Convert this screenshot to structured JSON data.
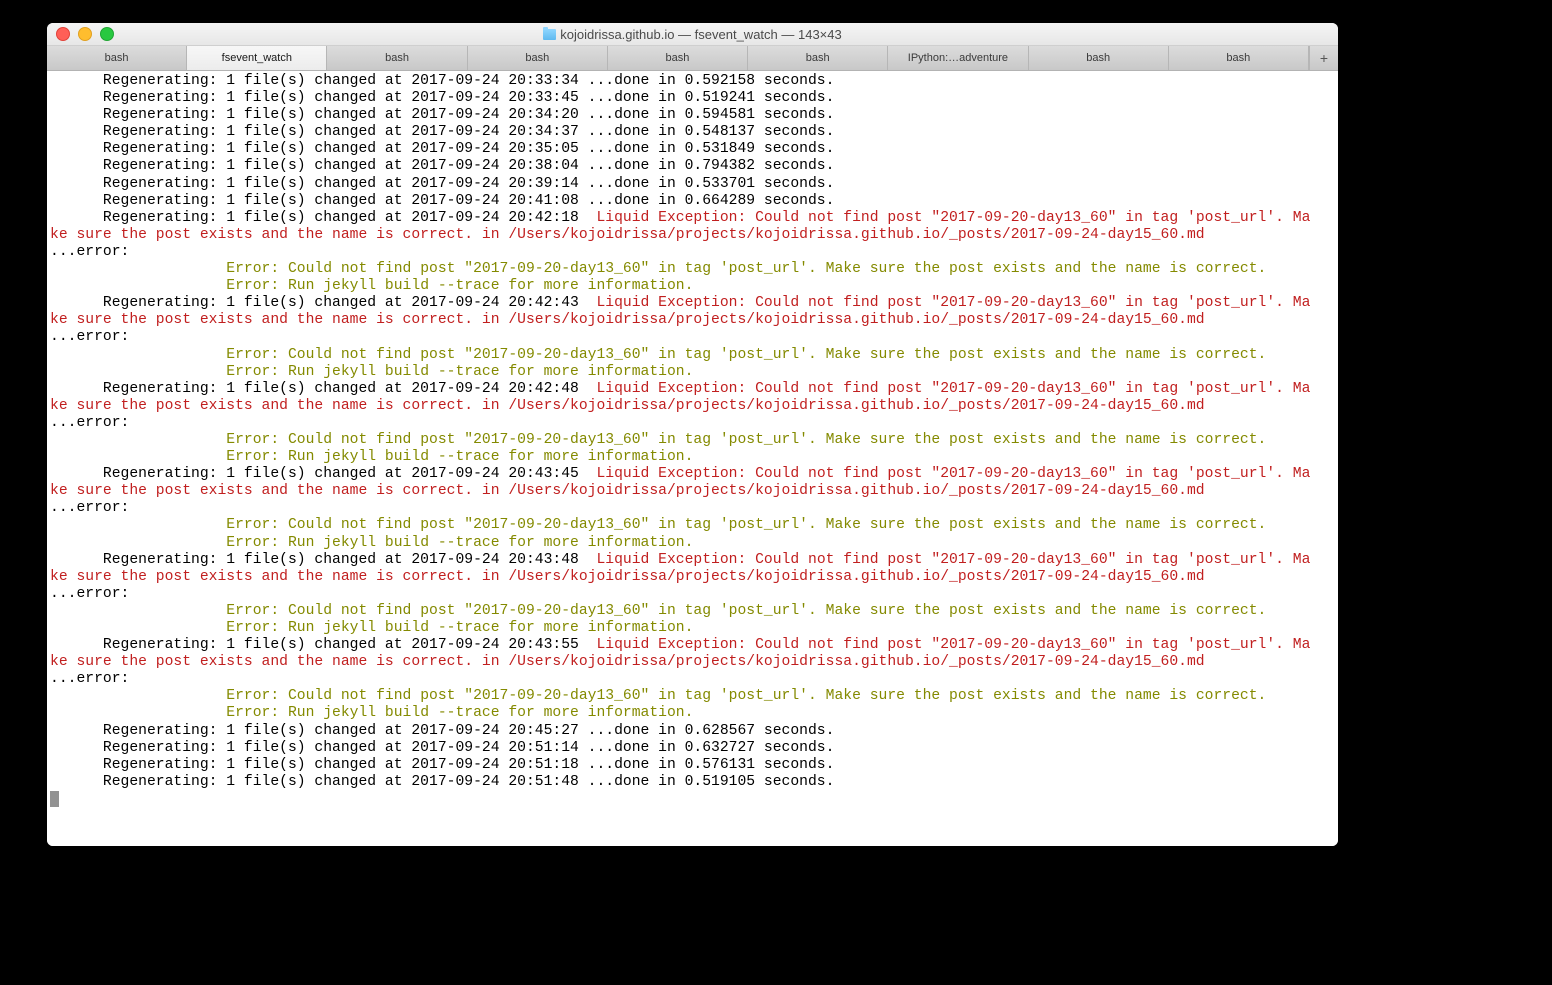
{
  "window": {
    "title": "kojoidrissa.github.io — fsevent_watch — 143×43",
    "tabs": [
      {
        "label": "bash",
        "active": false
      },
      {
        "label": "fsevent_watch",
        "active": true
      },
      {
        "label": "bash",
        "active": false
      },
      {
        "label": "bash",
        "active": false
      },
      {
        "label": "bash",
        "active": false
      },
      {
        "label": "bash",
        "active": false
      },
      {
        "label": "IPython:…adventure",
        "active": false
      },
      {
        "label": "bash",
        "active": false
      },
      {
        "label": "bash",
        "active": false
      }
    ],
    "new_tab_glyph": "+"
  },
  "colors": {
    "error_red": "#c11f1f",
    "warn_yellow": "#848a00",
    "text_black": "#000000"
  },
  "terminal": {
    "successful_runs_top": [
      {
        "time": "2017-09-24 20:33:34",
        "seconds": "0.592158"
      },
      {
        "time": "2017-09-24 20:33:45",
        "seconds": "0.519241"
      },
      {
        "time": "2017-09-24 20:34:20",
        "seconds": "0.594581"
      },
      {
        "time": "2017-09-24 20:34:37",
        "seconds": "0.548137"
      },
      {
        "time": "2017-09-24 20:35:05",
        "seconds": "0.531849"
      },
      {
        "time": "2017-09-24 20:38:04",
        "seconds": "0.794382"
      },
      {
        "time": "2017-09-24 20:39:14",
        "seconds": "0.533701"
      },
      {
        "time": "2017-09-24 20:41:08",
        "seconds": "0.664289"
      }
    ],
    "error_runs": [
      {
        "time": "2017-09-24 20:42:18"
      },
      {
        "time": "2017-09-24 20:42:43"
      },
      {
        "time": "2017-09-24 20:42:48"
      },
      {
        "time": "2017-09-24 20:43:45"
      },
      {
        "time": "2017-09-24 20:43:48"
      },
      {
        "time": "2017-09-24 20:43:55"
      }
    ],
    "liquid_exception_msg": "Liquid Exception: Could not find post \"2017-09-20-day13_60\" in tag 'post_url'. Make sure the post exists and the name is correct. in /Users/kojoidrissa/projects/kojoidrissa.github.io/_posts/2017-09-24-day15_60.md",
    "error_prefix": "...error:",
    "yellow_error_1": "Error: Could not find post \"2017-09-20-day13_60\" in tag 'post_url'. Make sure the post exists and the name is correct.",
    "yellow_error_2": "Error: Run jekyll build --trace for more information.",
    "successful_runs_bottom": [
      {
        "time": "2017-09-24 20:45:27",
        "seconds": "0.628567"
      },
      {
        "time": "2017-09-24 20:51:14",
        "seconds": "0.632727"
      },
      {
        "time": "2017-09-24 20:51:18",
        "seconds": "0.576131"
      },
      {
        "time": "2017-09-24 20:51:48",
        "seconds": "0.519105"
      }
    ]
  }
}
